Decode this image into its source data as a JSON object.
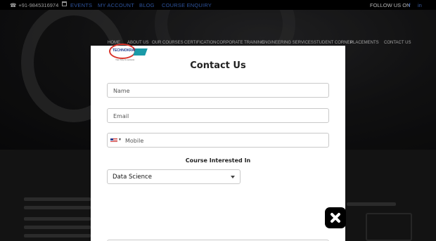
{
  "topbar": {
    "phone": "+91-9845316974",
    "links": [
      "EVENTS",
      "MY ACCOUNT",
      "BLOG",
      "COURSE ENQUIRY"
    ],
    "follow": "FOLLOW US ON",
    "social": [
      "f",
      "in"
    ]
  },
  "nav": [
    "HOME",
    "ABOUT US",
    "OUR COURSES",
    "CERTIFICATION",
    "CORPORATE TRAINING",
    "ENGINEERING SERVICES",
    "STUDENT CORNER",
    "PLACEMENTS",
    "CONTACT US"
  ],
  "modal": {
    "logo_text": "TECHNOKRAFT",
    "logo_tagline": "Your Key to success",
    "title": "Contact Us",
    "name_placeholder": "Name",
    "email_placeholder": "Email",
    "mobile_placeholder": "Mobile",
    "course_label": "Course Interested In",
    "course_selected": "Data Science"
  },
  "icons": {
    "phone": "phone-icon",
    "calendar": "calendar-icon",
    "close": "close-icon",
    "flag": "us-flag-icon"
  }
}
